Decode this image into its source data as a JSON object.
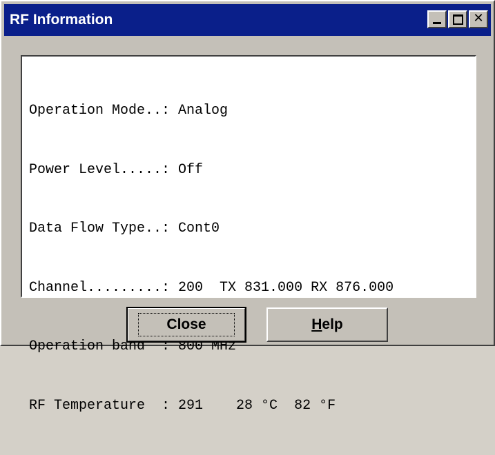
{
  "window": {
    "title": "RF Information"
  },
  "info": {
    "lines": [
      "Operation Mode..: Analog",
      "Power Level.....: Off",
      "Data Flow Type..: Cont0",
      "Channel.........: 200  TX 831.000 RX 876.000",
      "Operation band  : 800 MHz",
      "RF Temperature  : 291    28 °C  82 °F"
    ]
  },
  "buttons": {
    "close_label": "Close",
    "help_label_prefix": "H",
    "help_label_rest": "elp"
  },
  "title_buttons": {
    "close_glyph": "✕"
  }
}
